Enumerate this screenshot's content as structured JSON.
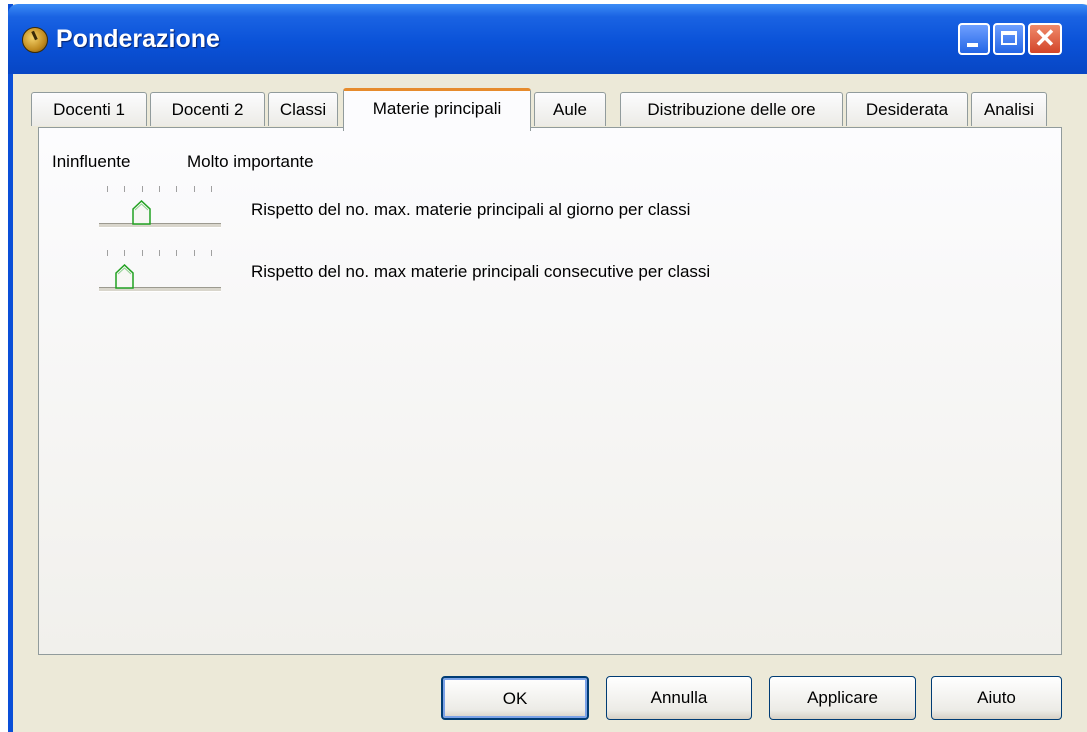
{
  "window": {
    "title": "Ponderazione"
  },
  "tabs": [
    {
      "label": "Docenti 1"
    },
    {
      "label": "Docenti 2"
    },
    {
      "label": "Classi"
    },
    {
      "label": "Materie principali",
      "active": true
    },
    {
      "label": "Aule"
    },
    {
      "label": "Distribuzione delle ore"
    },
    {
      "label": "Desiderata"
    },
    {
      "label": "Analisi"
    }
  ],
  "scale": {
    "min_label": "Ininfluente",
    "max_label": "Molto importante"
  },
  "rows": [
    {
      "label": "Rispetto del no. max. materie principali al giorno per classi",
      "value": 2,
      "max": 6
    },
    {
      "label": "Rispetto del no. max materie principali consecutive per classi",
      "value": 1,
      "max": 6
    }
  ],
  "buttons": {
    "ok": "OK",
    "cancel": "Annulla",
    "apply": "Applicare",
    "help": "Aiuto"
  },
  "colors": {
    "titlebar": "#0a52d8",
    "active_tab_accent": "#e68b2c",
    "thumb_accent": "#21a121"
  },
  "icons": {
    "app": "app-icon",
    "minimize": "minimize-icon",
    "maximize": "maximize-icon",
    "close": "close-icon"
  }
}
